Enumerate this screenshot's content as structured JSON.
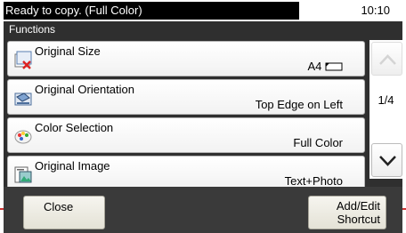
{
  "status": {
    "message": "Ready to copy. (Full Color)",
    "time": "10:10"
  },
  "panel": {
    "title": "Functions"
  },
  "functions": [
    {
      "label": "Original Size",
      "value": "A4",
      "icon": "original-size-icon"
    },
    {
      "label": "Original Orientation",
      "value": "Top Edge on Left",
      "icon": "original-orientation-icon"
    },
    {
      "label": "Color Selection",
      "value": "Full Color",
      "icon": "color-selection-icon"
    },
    {
      "label": "Original Image",
      "value": "Text+Photo",
      "icon": "original-image-icon"
    }
  ],
  "pager": {
    "page": "1/4"
  },
  "buttons": {
    "close": "Close",
    "add_edit_line1": "Add/Edit",
    "add_edit_line2": "Shortcut"
  },
  "colors": {
    "panel_bg": "#2f2f2f",
    "callout": "#cc3333"
  }
}
